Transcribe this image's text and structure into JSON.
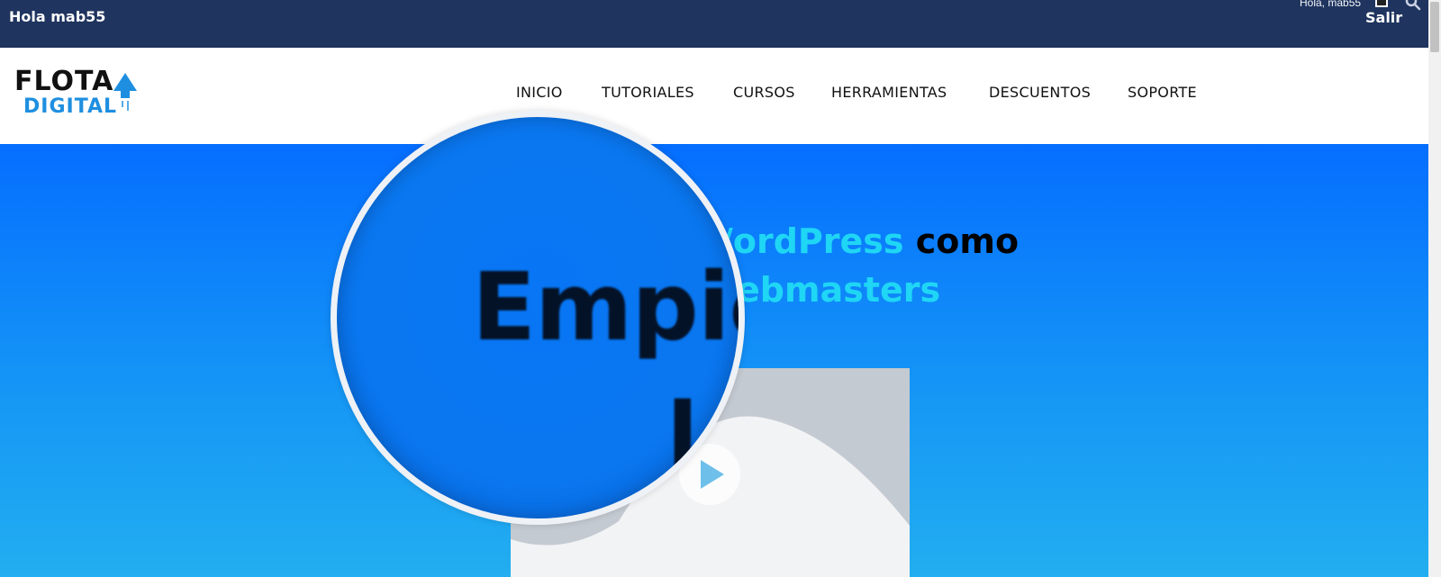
{
  "topbar": {
    "greeting": "Hola mab55",
    "account_label": "Hola, mab55",
    "account_icon": "account-icon",
    "search_icon": "search-icon",
    "logout_label": "Salir"
  },
  "logo": {
    "line1": "FLOTA",
    "line2": "DIGITAL",
    "icon": "rocket-icon"
  },
  "nav": {
    "items": [
      {
        "label": "INICIO"
      },
      {
        "label": "TUTORIALES"
      },
      {
        "label": "CURSOS"
      },
      {
        "label": "HERRAMIENTAS"
      },
      {
        "label": "DESCUENTOS"
      },
      {
        "label": "SOPORTE"
      }
    ]
  },
  "hero": {
    "line1_accent": "/ordPress",
    "line1_rest": "como",
    "line2_accent": "ebmasters",
    "play_icon": "play-icon"
  },
  "magnifier": {
    "text": "Empie",
    "text2": "l"
  },
  "colors": {
    "topbar": "#1f345f",
    "accent": "#1fd6f5",
    "hero_top": "#056eff",
    "hero_bottom": "#22aef0",
    "logo_blue": "#1e8fe0"
  }
}
